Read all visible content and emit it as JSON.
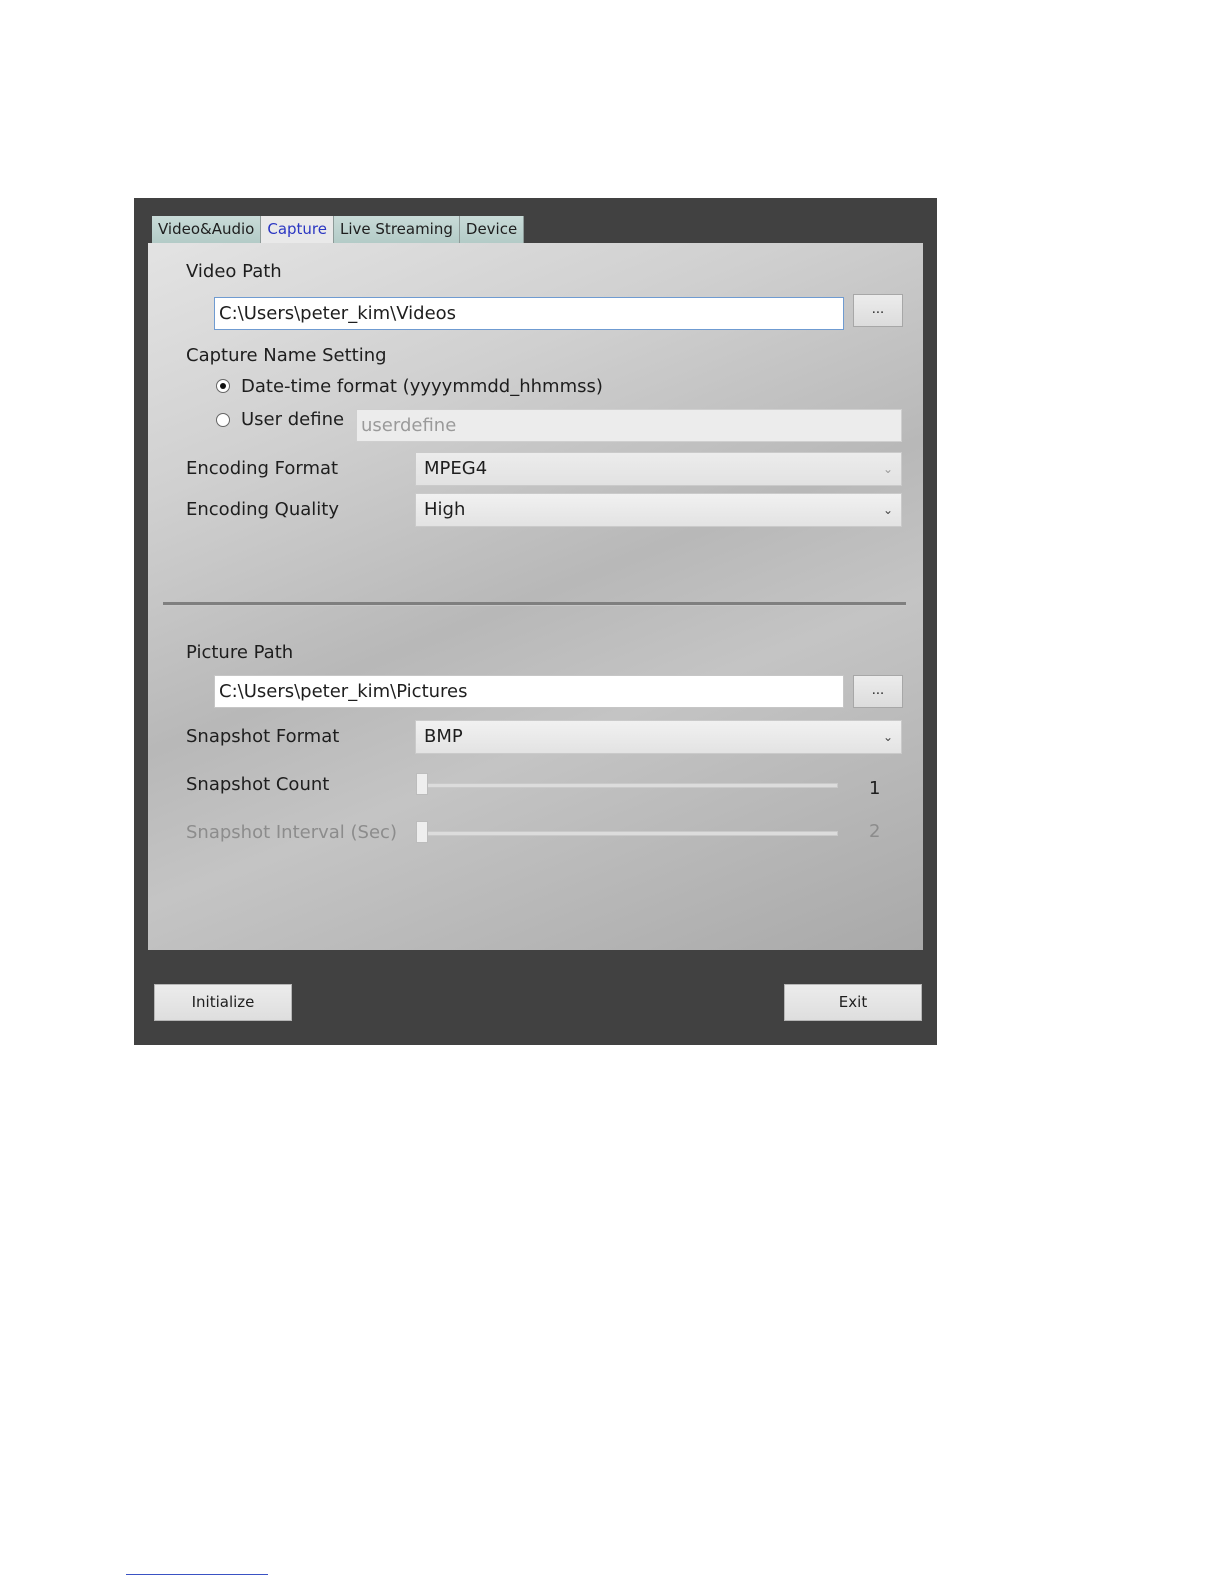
{
  "tabs": [
    {
      "label": "Video&Audio"
    },
    {
      "label": "Capture"
    },
    {
      "label": "Live Streaming"
    },
    {
      "label": "Device"
    }
  ],
  "active_tab": "Capture",
  "video_path": {
    "label": "Video Path",
    "value": "C:\\Users\\peter_kim\\Videos",
    "browse_label": "..."
  },
  "capture_name": {
    "label": "Capture Name Setting",
    "option_datetime": "Date-time format (yyyymmdd_hhmmss)",
    "option_user": "User define",
    "user_define_placeholder": "userdefine",
    "selected": "datetime"
  },
  "encoding_format": {
    "label": "Encoding Format",
    "value": "MPEG4"
  },
  "encoding_quality": {
    "label": "Encoding Quality",
    "value": "High"
  },
  "picture_path": {
    "label": "Picture Path",
    "value": "C:\\Users\\peter_kim\\Pictures",
    "browse_label": "..."
  },
  "snapshot_format": {
    "label": "Snapshot Format",
    "value": "BMP"
  },
  "snapshot_count": {
    "label": "Snapshot Count",
    "value": "1"
  },
  "snapshot_interval": {
    "label": "Snapshot Interval (Sec)",
    "value": "2"
  },
  "buttons": {
    "initialize": "Initialize",
    "exit": "Exit"
  },
  "colors": {
    "window_bg": "#414141",
    "tab_bg": "#c9dbd8",
    "active_tab_text": "#2b36c2"
  }
}
